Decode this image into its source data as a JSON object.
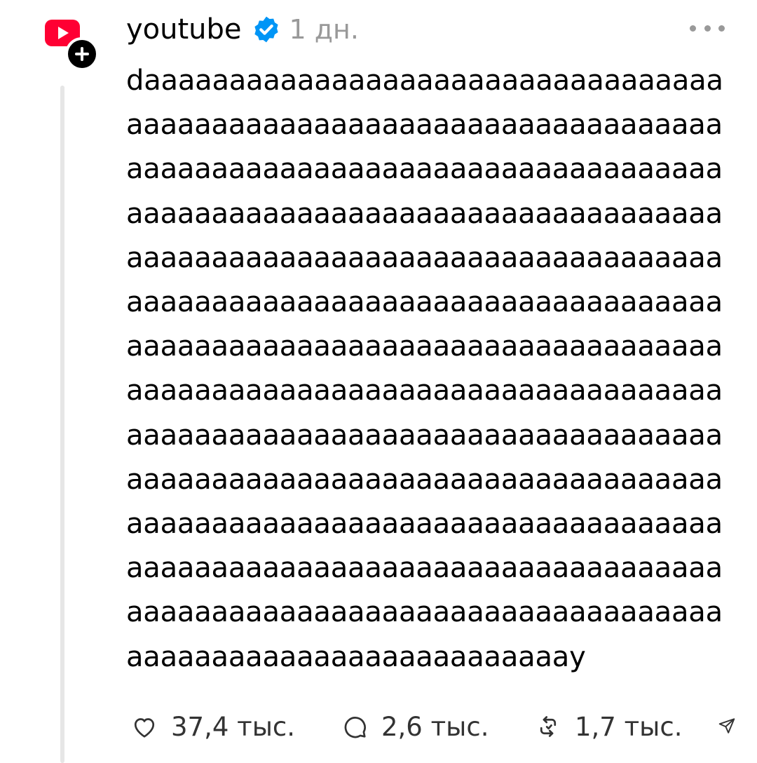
{
  "post": {
    "username": "youtube",
    "time_ago": "1 дн.",
    "text": "daaaaaaaaaaaaaaaaaaaaaaaaaaaaaaaaaaaaaaaaaaaaaaaaaaaaaaaaaaaaaaaaaaaaaaaaaaaaaaaaaaaaaaaaaaaaaaaaaaaaaaaaaaaaaaaaaaaaaaaaaaaaaaaaaaaaaaaaaaaaaaaaaaaaaaaaaaaaaaaaaaaaaaaaaaaaaaaaaaaaaaaaaaaaaaaaaaaaaaaaaaaaaaaaaaaaaaaaaaaaaaaaaaaaaaaaaaaaaaaaaaaaaaaaaaaaaaaaaaaaaaaaaaaaaaaaaaaaaaaaaaaaaaaaaaaaaaaaaaaaaaaaaaaaaaaaaaaaaaaaaaaaaaaaaaaaaaaaaaaaaaaaaaaaaaaaaaaaaaaaaaaaaaaaaaaaaaaaaaaaaaaaaaaaaaaaaaaaaaaaaaaaaaaaaaaaaaaaaaaaaaaaaaaaaaaaaaaaaaaaaaaaaaaaaaaaaaaaaaaaaaaaaaaaaaaaaaaaaaaay",
    "likes": "37,4 тыс.",
    "replies": "2,6 тыс.",
    "reposts": "1,7 тыс."
  },
  "icons": {
    "avatar": "youtube-logo-icon",
    "follow": "plus-icon",
    "verified": "verified-badge-icon",
    "more": "more-horizontal-icon",
    "like": "heart-icon",
    "reply": "comment-icon",
    "repost": "repost-icon",
    "share": "share-icon"
  },
  "colors": {
    "brand": "#ff0033",
    "verified": "#0095f6",
    "muted": "#999999"
  }
}
